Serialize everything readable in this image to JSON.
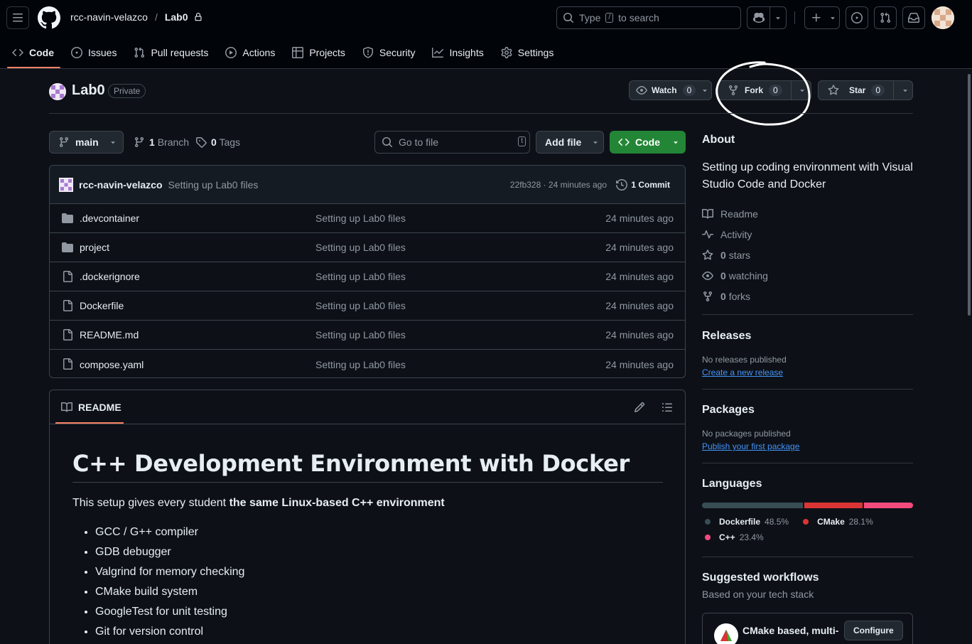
{
  "header": {
    "owner": "rcc-navin-velazco",
    "separator": "/",
    "repo": "Lab0",
    "search_pre": "Type",
    "search_key": "/",
    "search_post": "to search"
  },
  "tabs": [
    {
      "label": "Code"
    },
    {
      "label": "Issues"
    },
    {
      "label": "Pull requests"
    },
    {
      "label": "Actions"
    },
    {
      "label": "Projects"
    },
    {
      "label": "Security"
    },
    {
      "label": "Insights"
    },
    {
      "label": "Settings"
    }
  ],
  "repo": {
    "name": "Lab0",
    "visibility": "Private",
    "watch_label": "Watch",
    "watch_count": "0",
    "fork_label": "Fork",
    "fork_count": "0",
    "star_label": "Star",
    "star_count": "0"
  },
  "filenav": {
    "branch": "main",
    "branch_count": "1",
    "branch_word": "Branch",
    "tag_count": "0",
    "tag_word": "Tags",
    "goto_placeholder": "Go to file",
    "goto_key": "t",
    "add_file": "Add file",
    "code_btn": "Code"
  },
  "commit": {
    "author": "rcc-navin-velazco",
    "message": "Setting up Lab0 files",
    "sha_time": "22fb328 · 24 minutes ago",
    "commits": "1 Commit"
  },
  "files": [
    {
      "type": "dir",
      "name": ".devcontainer",
      "message": "Setting up Lab0 files",
      "time": "24 minutes ago"
    },
    {
      "type": "dir",
      "name": "project",
      "message": "Setting up Lab0 files",
      "time": "24 minutes ago"
    },
    {
      "type": "file",
      "name": ".dockerignore",
      "message": "Setting up Lab0 files",
      "time": "24 minutes ago"
    },
    {
      "type": "file",
      "name": "Dockerfile",
      "message": "Setting up Lab0 files",
      "time": "24 minutes ago"
    },
    {
      "type": "file",
      "name": "README.md",
      "message": "Setting up Lab0 files",
      "time": "24 minutes ago"
    },
    {
      "type": "file",
      "name": "compose.yaml",
      "message": "Setting up Lab0 files",
      "time": "24 minutes ago"
    }
  ],
  "readme": {
    "tab": "README",
    "heading": "C++ Development Environment with Docker",
    "intro_pre": "This setup gives every student ",
    "intro_bold": "the same Linux-based C++ environment",
    "items": [
      "GCC / G++ compiler",
      "GDB debugger",
      "Valgrind for memory checking",
      "CMake build system",
      "GoogleTest for unit testing",
      "Git for version control"
    ]
  },
  "about": {
    "title": "About",
    "description": "Setting up coding environment with Visual Studio Code and Docker",
    "readme": "Readme",
    "activity": "Activity",
    "stars_count": "0",
    "stars_word": "stars",
    "watching_count": "0",
    "watching_word": "watching",
    "forks_count": "0",
    "forks_word": "forks"
  },
  "releases": {
    "title": "Releases",
    "none": "No releases published",
    "link": "Create a new release"
  },
  "packages": {
    "title": "Packages",
    "none": "No packages published",
    "link": "Publish your first package"
  },
  "languages": {
    "title": "Languages",
    "items": [
      {
        "name": "Dockerfile",
        "pct": "48.5%",
        "value": 48.5,
        "color": "#384d54"
      },
      {
        "name": "CMake",
        "pct": "28.1%",
        "value": 28.1,
        "color": "#da3434"
      },
      {
        "name": "C++",
        "pct": "23.4%",
        "value": 23.4,
        "color": "#f34b7d"
      }
    ]
  },
  "workflows": {
    "title": "Suggested workflows",
    "subtitle": "Based on your tech stack",
    "card_title": "CMake based, multi-",
    "configure": "Configure"
  },
  "colors": {
    "accent": "#f78166",
    "link": "#4493f8",
    "green": "#238636"
  }
}
